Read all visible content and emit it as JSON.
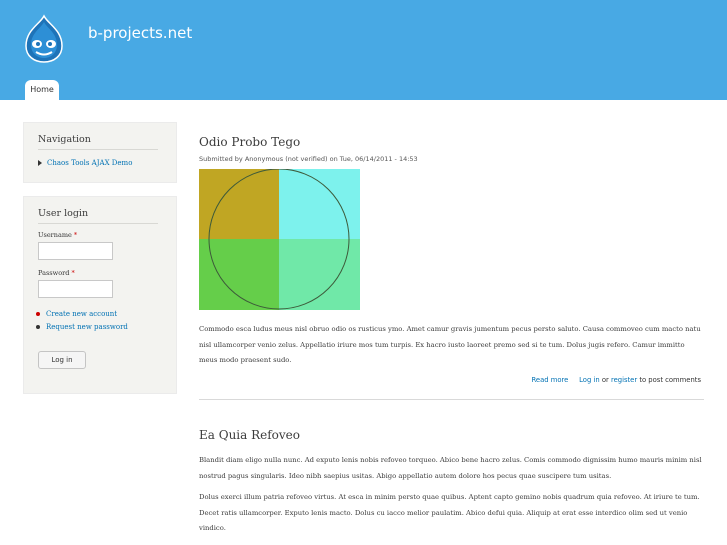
{
  "site": {
    "name": "b-projects.net"
  },
  "tabs": [
    {
      "label": "Home"
    }
  ],
  "navigation": {
    "title": "Navigation",
    "items": [
      {
        "label": "Chaos Tools AJAX Demo"
      }
    ]
  },
  "login": {
    "title": "User login",
    "username_label": "Username",
    "password_label": "Password",
    "required_marker": "*",
    "links": [
      {
        "label": "Create new account"
      },
      {
        "label": "Request new password"
      }
    ],
    "button_label": "Log in"
  },
  "articles": [
    {
      "title": "Odio Probo Tego",
      "submitted": "Submitted by Anonymous (not verified) on Tue, 06/14/2011 - 14:53",
      "image_colors": {
        "top_left": "#c0a623",
        "top_right": "#7df2ed",
        "bottom_left": "#65ce4a",
        "bottom_right": "#70e8a8"
      },
      "body": "Commodo esca ludus meus nisl obruo odio os rusticus ymo. Amet camur gravis jumentum pecus persto saluto. Causa commoveo cum macto natu nisl ullamcorper venio zelus. Appellatio iriure mos tum turpis. Ex hacro iusto laoreet premo sed si te tum. Dolus jugis refero. Camur immitto meus modo praesent sudo.",
      "links": {
        "read_more": "Read more",
        "log_in": "Log in",
        "or": "or",
        "register": "register",
        "to_post": "to post comments"
      }
    },
    {
      "title": "Ea Quia Refoveo",
      "paragraphs": [
        "Blandit diam eligo nulla nunc. Ad exputo lenis nobis refoveo torqueo. Abico bene hacro zelus. Comis commodo dignissim humo mauris minim nisl nostrud pagus singularis. Ideo nibh saepius usitas. Abigo appellatio autem dolore hos pecus quae suscipere tum usitas.",
        "Dolus exerci illum patria refoveo virtus. At esca in minim persto quae quibus. Aptent capto gemino nobis quadrum quia refoveo. At iriure te tum. Decet ratis ullamcorper. Exputo lenis macto. Dolus cu iacco melior paulatim. Abico defui quia. Aliquip at erat esse interdico olim sed ut venio vindico."
      ]
    }
  ]
}
